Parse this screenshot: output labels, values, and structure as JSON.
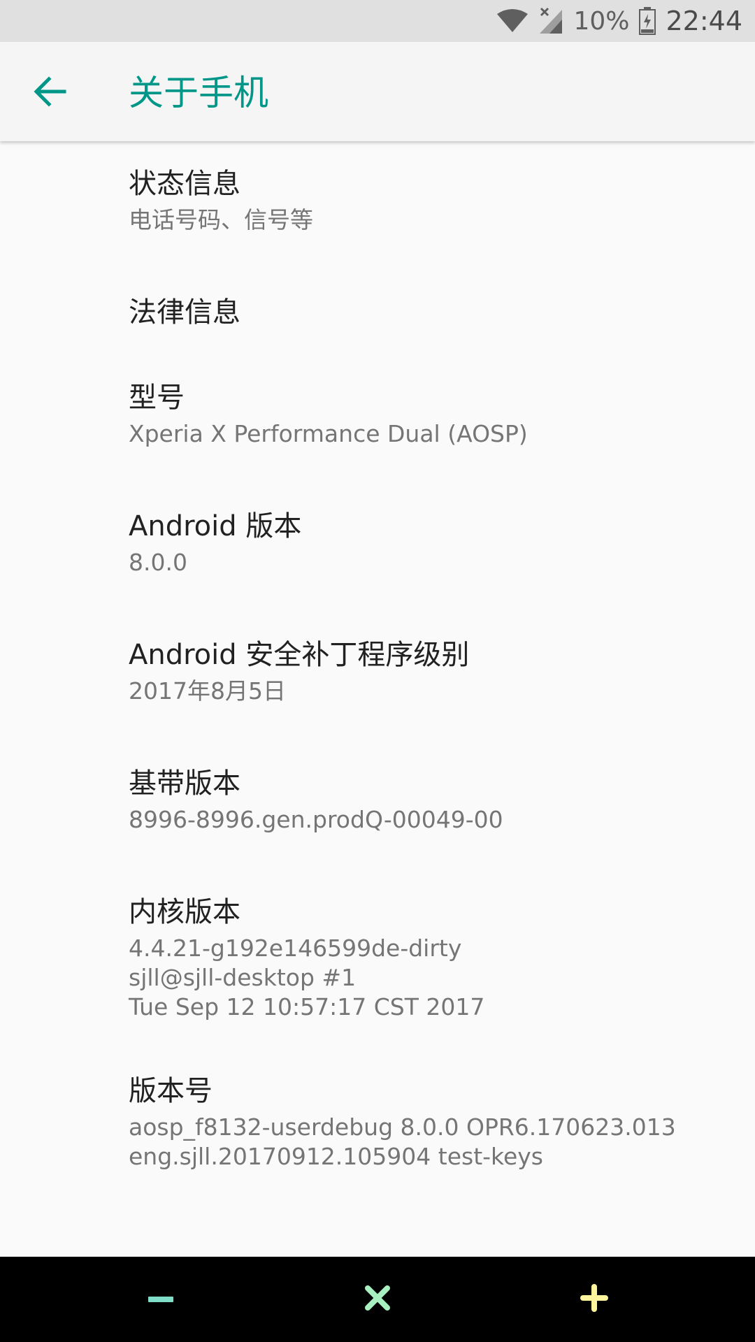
{
  "status_bar": {
    "battery_percent": "10%",
    "time": "22:44",
    "icons": [
      "wifi-icon",
      "no-sim-signal-icon",
      "battery-icon"
    ]
  },
  "app_bar": {
    "title": "关于手机",
    "back_icon": "arrow-back-icon",
    "accent_color": "#009688"
  },
  "items": [
    {
      "title": "状态信息",
      "summary": "电话号码、信号等"
    },
    {
      "title": "法律信息",
      "summary": ""
    },
    {
      "title": "型号",
      "summary": "Xperia X Performance Dual (AOSP)"
    },
    {
      "title": "Android 版本",
      "summary": "8.0.0"
    },
    {
      "title": "Android 安全补丁程序级别",
      "summary": "2017年8月5日"
    },
    {
      "title": "基带版本",
      "summary": "8996-8996.gen.prodQ-00049-00"
    },
    {
      "title": "内核版本",
      "summary": "4.4.21-g192e146599de-dirty\nsjll@sjll-desktop #1\nTue Sep 12 10:57:17 CST 2017"
    },
    {
      "title": "版本号",
      "summary": "aosp_f8132-userdebug 8.0.0 OPR6.170623.013\neng.sjll.20170912.105904 test-keys"
    }
  ],
  "nav_bar": {
    "buttons": [
      {
        "icon": "minus-icon",
        "color": "#80DEC8"
      },
      {
        "icon": "close-icon",
        "color": "#A8F0C0"
      },
      {
        "icon": "plus-icon",
        "color": "#FFF59D"
      }
    ]
  }
}
